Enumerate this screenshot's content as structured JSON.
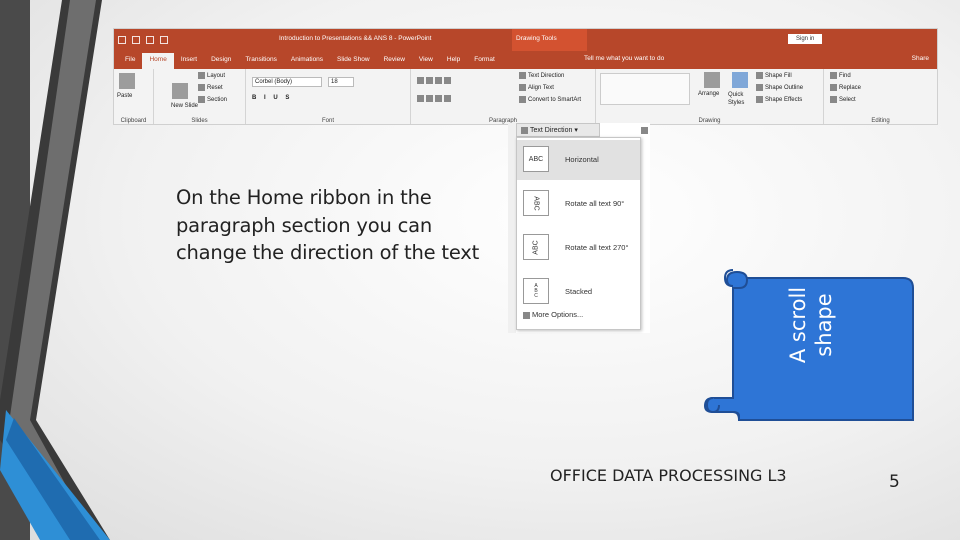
{
  "slide": {
    "instruction": "On the Home ribbon in the paragraph section you can change the direction of the text",
    "scroll_label": "A scroll shape",
    "footer": "OFFICE DATA PROCESSING L3",
    "page_number": "5"
  },
  "ribbon": {
    "doc_title": "Introduction to Presentations && ANS 8 - PowerPoint",
    "drawing_tools": "Drawing Tools",
    "sign_in": "Sign in",
    "tabs": [
      "File",
      "Home",
      "Insert",
      "Design",
      "Transitions",
      "Animations",
      "Slide Show",
      "Review",
      "View",
      "Help",
      "Format"
    ],
    "tell_me": "Tell me what you want to do",
    "share": "Share",
    "groups": {
      "clipboard": "Clipboard",
      "slides": "Slides",
      "font": "Font",
      "paragraph": "Paragraph",
      "drawing": "Drawing",
      "editing": "Editing"
    },
    "commands": {
      "paste": "Paste",
      "new_slide": "New Slide",
      "layout": "Layout",
      "reset": "Reset",
      "section": "Section",
      "font_name": "Corbel (Body)",
      "font_size": "18",
      "text_direction": "Text Direction",
      "align_text": "Align Text",
      "convert_smartart": "Convert to SmartArt",
      "arrange": "Arrange",
      "quick_styles": "Quick Styles",
      "shape_fill": "Shape Fill",
      "shape_outline": "Shape Outline",
      "shape_effects": "Shape Effects",
      "find": "Find",
      "replace": "Replace",
      "select": "Select"
    }
  },
  "text_direction_menu": {
    "header": "Text Direction",
    "box_text": "ABC",
    "items": [
      "Horizontal",
      "Rotate all text 90°",
      "Rotate all text 270°",
      "Stacked"
    ],
    "more_options": "More Options..."
  },
  "colors": {
    "ribbon_accent": "#b7472a",
    "scroll_fill": "#2e75d6",
    "scroll_outline": "#1f4e96"
  }
}
